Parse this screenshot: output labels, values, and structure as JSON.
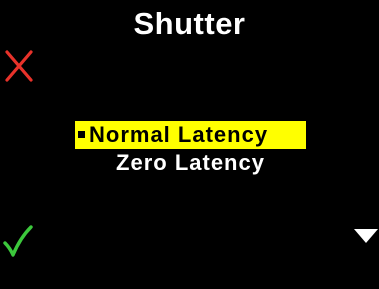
{
  "screen": {
    "title": "Shutter"
  },
  "menu": {
    "options": [
      {
        "label": "Normal Latency",
        "selected": true
      },
      {
        "label": "Zero Latency",
        "selected": false
      }
    ]
  },
  "softkeys": {
    "cancel_icon": "cross-icon",
    "confirm_icon": "checkmark-icon",
    "down_icon": "down-triangle-icon"
  },
  "colors": {
    "background": "#000000",
    "highlight": "#ffff00",
    "cancel": "#e8322a",
    "confirm": "#3cc83c",
    "text": "#ffffff"
  }
}
